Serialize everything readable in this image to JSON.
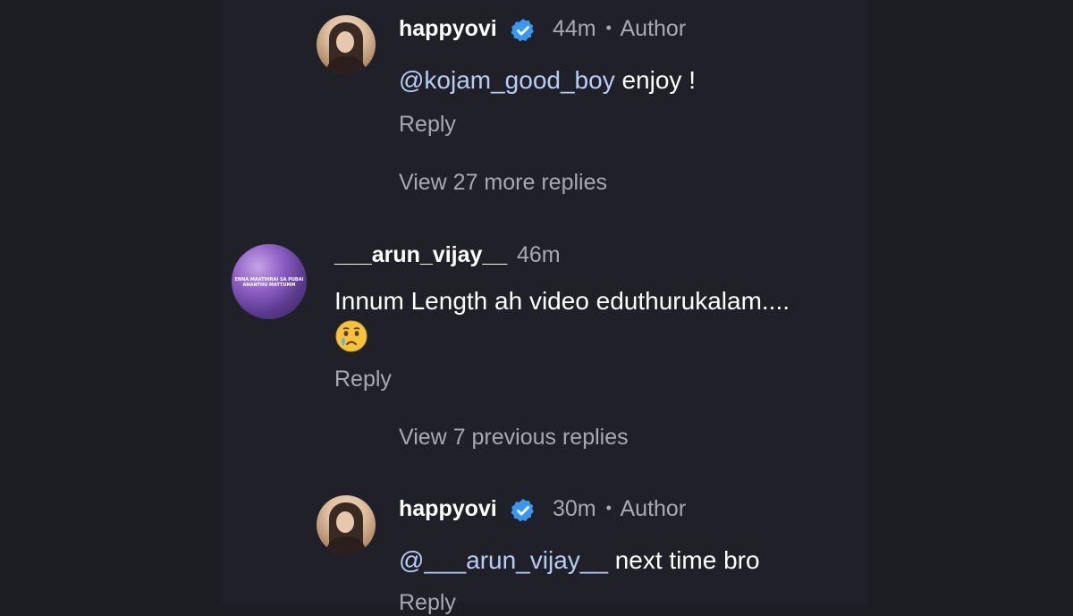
{
  "comments": [
    {
      "username": "happyovi",
      "time": "44m",
      "separator": "•",
      "role": "Author",
      "mention": "@kojam_good_boy",
      "text": " enjoy !",
      "reply_label": "Reply"
    },
    {
      "username": "___arun_vijay__",
      "time": "46m",
      "text": "Innum Length ah video eduthurukalam....",
      "emoji": "crying-face",
      "reply_label": "Reply",
      "avatar_text": [
        "ENNA MAATHIRAI SA PUBAI",
        "ANANTHU MATTUMM"
      ]
    },
    {
      "username": "happyovi",
      "time": "30m",
      "separator": "•",
      "role": "Author",
      "mention": "@___arun_vijay__",
      "text": " next time bro",
      "reply_label": "Reply"
    }
  ],
  "view_more_replies": "View 27 more replies",
  "view_previous_replies": "View 7 previous replies",
  "colors": {
    "background": "#1d1e24",
    "text": "#ffffff",
    "muted": "#a9aab0",
    "mention": "#b8cdf6",
    "verified": "#3897f0"
  }
}
